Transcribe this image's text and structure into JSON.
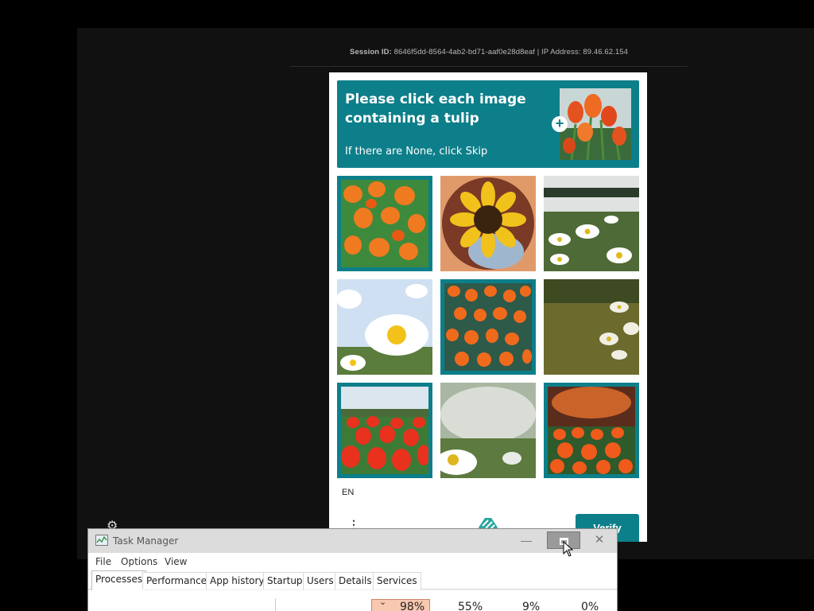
{
  "session": {
    "label": "Session ID:",
    "id": "8646f5dd-8564-4ab2-bd71-aaf0e28d8eaf | IP Address:",
    "ip": "89.46.62.154"
  },
  "captcha": {
    "title": "Please click each image containing a tulip",
    "subtitle": "If there are None, click Skip",
    "plus": "+",
    "tiles": [
      {
        "subject": "tulips",
        "selected": true
      },
      {
        "subject": "sunflower",
        "selected": false
      },
      {
        "subject": "daisies",
        "selected": false
      },
      {
        "subject": "daisy",
        "selected": false
      },
      {
        "subject": "tulips",
        "selected": true
      },
      {
        "subject": "daisies",
        "selected": false
      },
      {
        "subject": "tulip field",
        "selected": true
      },
      {
        "subject": "daisy",
        "selected": false
      },
      {
        "subject": "tulip field",
        "selected": true
      }
    ],
    "language": "EN",
    "menu": "⋮",
    "verify_label": "Verify",
    "accent": "#0d7f8a"
  },
  "settings_icon": "gear-icon",
  "task_manager": {
    "title": "Task Manager",
    "menu": [
      "File",
      "Options",
      "View"
    ],
    "tabs": [
      "Processes",
      "Performance",
      "App history",
      "Startup",
      "Users",
      "Details",
      "Services"
    ],
    "active_tab": "Processes",
    "cpu": "98%",
    "memory": "55%",
    "disk": "9%",
    "network": "0%",
    "cpu_highlight": "#f9c8b0",
    "minimize": "—",
    "close": "✕"
  }
}
